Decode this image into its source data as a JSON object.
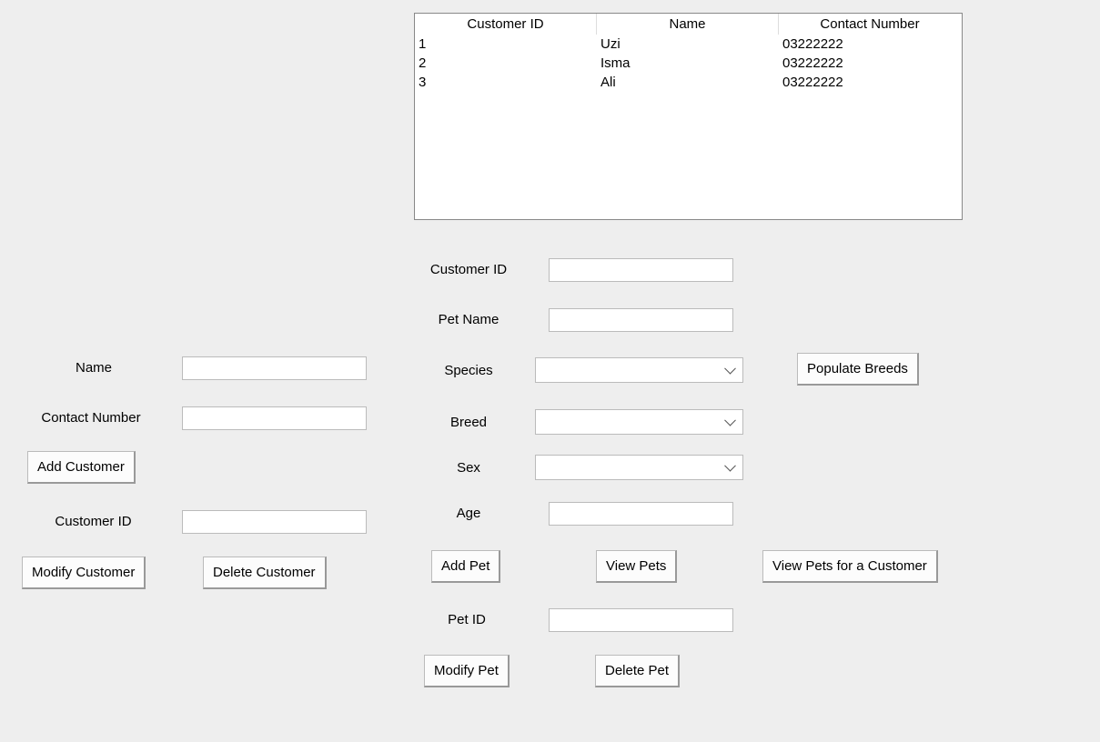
{
  "table": {
    "headers": [
      "Customer ID",
      "Name",
      "Contact Number"
    ],
    "rows": [
      {
        "id": "1",
        "name": "Uzi",
        "contact": "03222222"
      },
      {
        "id": "2",
        "name": "Isma",
        "contact": "03222222"
      },
      {
        "id": "3",
        "name": "Ali",
        "contact": "03222222"
      }
    ]
  },
  "customer_form": {
    "labels": {
      "name": "Name",
      "contact": "Contact Number",
      "customer_id": "Customer ID"
    },
    "values": {
      "name": "",
      "contact": "",
      "customer_id": ""
    },
    "buttons": {
      "add": "Add Customer",
      "modify": "Modify Customer",
      "delete": "Delete Customer"
    }
  },
  "pet_form": {
    "labels": {
      "customer_id": "Customer ID",
      "pet_name": "Pet Name",
      "species": "Species",
      "breed": "Breed",
      "sex": "Sex",
      "age": "Age",
      "pet_id": "Pet ID"
    },
    "values": {
      "customer_id": "",
      "pet_name": "",
      "species": "",
      "breed": "",
      "sex": "",
      "age": "",
      "pet_id": ""
    },
    "buttons": {
      "populate_breeds": "Populate Breeds",
      "add_pet": "Add Pet",
      "view_pets": "View Pets",
      "view_pets_customer": "View Pets for a Customer",
      "modify_pet": "Modify Pet",
      "delete_pet": "Delete Pet"
    }
  }
}
